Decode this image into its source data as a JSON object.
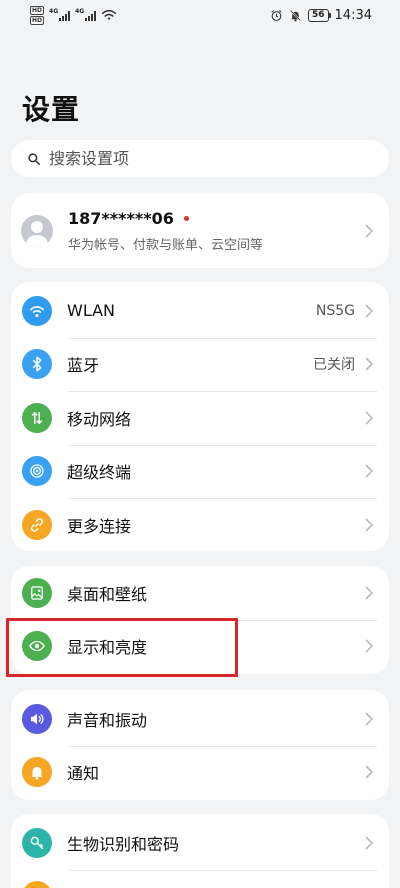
{
  "status_bar": {
    "sim1_tag": "HD",
    "sim2_tag": "HD",
    "net1": "4G",
    "net2": "4G",
    "battery": "56",
    "time": "14:34",
    "icons": [
      "alarm-icon",
      "mute-icon",
      "battery-icon",
      "wifi-icon",
      "signal-icon"
    ]
  },
  "page": {
    "title": "设置"
  },
  "search": {
    "placeholder": "搜索设置项"
  },
  "account": {
    "name": "187******06",
    "subtitle": "华为帐号、付款与账单、云空间等"
  },
  "groups": [
    {
      "items": [
        {
          "label": "WLAN",
          "value": "NS5G",
          "icon": "wifi-icon",
          "color": "#2f9cf0"
        },
        {
          "label": "蓝牙",
          "value": "已关闭",
          "icon": "bluetooth-icon",
          "color": "#3aa0f2"
        },
        {
          "label": "移动网络",
          "value": "",
          "icon": "mobile-network-icon",
          "color": "#4cb050"
        },
        {
          "label": "超级终端",
          "value": "",
          "icon": "super-device-icon",
          "color": "#3aa0f2"
        },
        {
          "label": "更多连接",
          "value": "",
          "icon": "link-icon",
          "color": "#f5a623"
        }
      ]
    },
    {
      "items": [
        {
          "label": "桌面和壁纸",
          "value": "",
          "icon": "wallpaper-icon",
          "color": "#4cb050"
        },
        {
          "label": "显示和亮度",
          "value": "",
          "icon": "eye-icon",
          "color": "#4cb050"
        }
      ]
    },
    {
      "items": [
        {
          "label": "声音和振动",
          "value": "",
          "icon": "sound-icon",
          "color": "#5a5ae0"
        },
        {
          "label": "通知",
          "value": "",
          "icon": "bell-icon",
          "color": "#f5a623"
        }
      ]
    },
    {
      "items": [
        {
          "label": "生物识别和密码",
          "value": "",
          "icon": "key-icon",
          "color": "#2bb5a8"
        },
        {
          "label": "",
          "value": "",
          "icon": "app-icon",
          "color": "#f5a623"
        }
      ]
    }
  ]
}
